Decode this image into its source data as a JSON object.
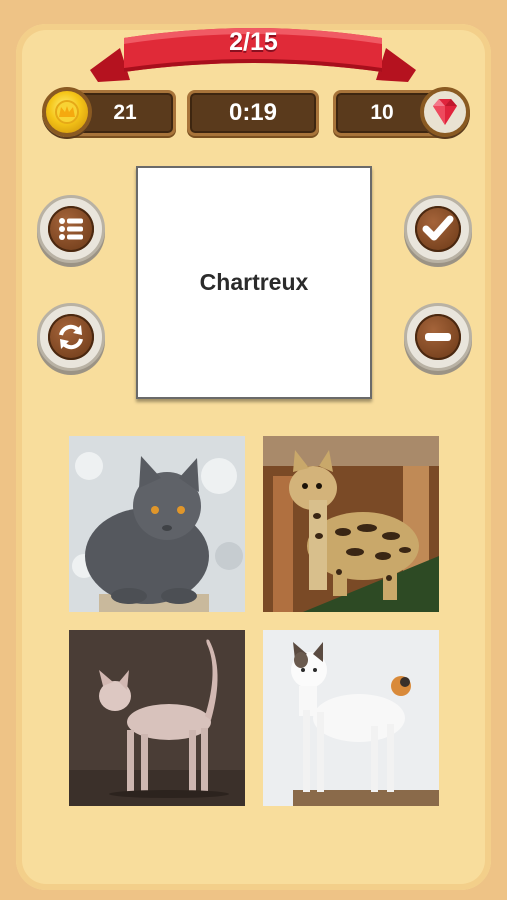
{
  "progress": {
    "label": "2/15"
  },
  "coins": {
    "value": "21",
    "icon": "coin-icon"
  },
  "timer": {
    "value": "0:19"
  },
  "gems": {
    "value": "10",
    "icon": "ruby-gem-icon"
  },
  "word_card": {
    "word": "Chartreux"
  },
  "buttons": [
    {
      "name": "list-button",
      "icon": "list-icon"
    },
    {
      "name": "refresh-button",
      "icon": "refresh-icon"
    },
    {
      "name": "check-button",
      "icon": "checkmark-icon"
    },
    {
      "name": "minus-button",
      "icon": "minus-icon"
    }
  ],
  "answer_options": [
    {
      "subject": "grey cat"
    },
    {
      "subject": "spotted wild cat"
    },
    {
      "subject": "hairless cat"
    },
    {
      "subject": "white and calico cat"
    }
  ],
  "colors": {
    "background": "#eec386",
    "panel": "#f8dd9c",
    "ribbon": "#d8202f",
    "wood": "#5a3a1c",
    "gem": "#e0243c"
  }
}
